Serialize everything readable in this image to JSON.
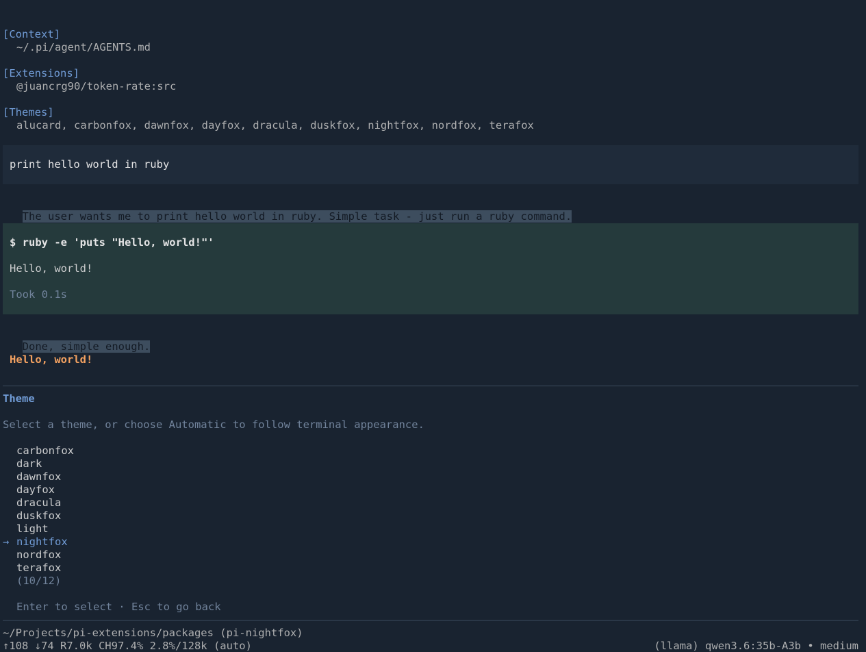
{
  "loaded": {
    "context_header": "[Context]",
    "context_item": "~/.pi/agent/AGENTS.md",
    "extensions_header": "[Extensions]",
    "extensions_item": "@juancrg90/token-rate:src",
    "themes_header": "[Themes]",
    "themes_item": "alucard, carbonfox, dawnfox, dayfox, dracula, duskfox, nightfox, nordfox, terafox"
  },
  "conversation": {
    "user_message": "print hello world in ruby",
    "thinking_1": "The user wants me to print hello world in ruby. Simple task - just run a ruby command.",
    "tool_command": "$ ruby -e 'puts \"Hello, world!\"'",
    "tool_output": "Hello, world!",
    "tool_duration": "Took 0.1s",
    "thinking_2": "Done, simple enough.",
    "assistant_reply": "Hello, world!"
  },
  "theme_picker": {
    "title": "Theme",
    "description": "Select a theme, or choose Automatic to follow terminal appearance.",
    "selected_arrow": "→",
    "items": [
      "carbonfox",
      "dark",
      "dawnfox",
      "dayfox",
      "dracula",
      "duskfox",
      "light",
      "nightfox",
      "nordfox",
      "terafox"
    ],
    "selected_index": 7,
    "counter": "(10/12)",
    "hint": "Enter to select · Esc to go back"
  },
  "footer": {
    "cwd": "~/Projects/pi-extensions/packages (pi-nightfox)",
    "stats": "↑108 ↓74 R7.0k CH97.4% 2.8%/128k (auto)",
    "model": "(llama) qwen3.6:35b-A3b • medium"
  },
  "colors": {
    "background": "#192330",
    "accent": "#719cd6",
    "orange": "#f4a261",
    "user_block": "#1f2b3a",
    "tool_block": "#253a3c"
  }
}
